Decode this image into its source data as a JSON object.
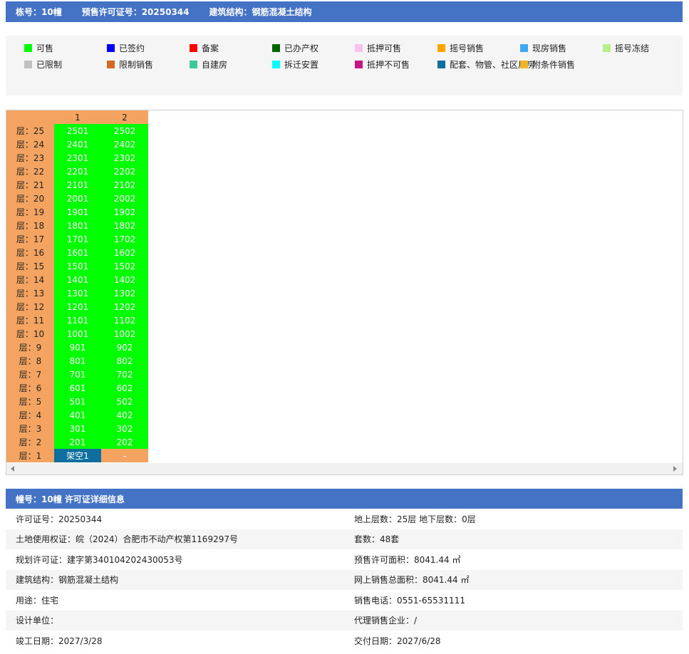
{
  "header": {
    "building": "栋号：10幢",
    "permit": "预售许可证号：20250344",
    "structure": "建筑结构：钢筋混凝土结构"
  },
  "legend": [
    {
      "label": "可售",
      "color": "#00ff00"
    },
    {
      "label": "已签约",
      "color": "#0000ff"
    },
    {
      "label": "备案",
      "color": "#ff0000"
    },
    {
      "label": "已办产权",
      "color": "#006400"
    },
    {
      "label": "抵押可售",
      "color": "#f9c0f2"
    },
    {
      "label": "摇号销售",
      "color": "#ffa500"
    },
    {
      "label": "现房销售",
      "color": "#3fa9f5"
    },
    {
      "label": "摇号冻结",
      "color": "#b3f08a"
    },
    {
      "label": "已限制",
      "color": "#c0c0c0"
    },
    {
      "label": "限制销售",
      "color": "#d2691e"
    },
    {
      "label": "自建房",
      "color": "#40c89a"
    },
    {
      "label": "拆迁安置",
      "color": "#00ffff"
    },
    {
      "label": "抵押不可售",
      "color": "#c71585"
    },
    {
      "label": "配套、物管、社区用房",
      "color": "#0e6e9e"
    },
    {
      "label": "附条件销售",
      "color": "#f0b429"
    }
  ],
  "grid": {
    "columns": [
      "1",
      "2"
    ],
    "floors": [
      {
        "label": "层：25",
        "units": [
          "2501",
          "2502"
        ]
      },
      {
        "label": "层：24",
        "units": [
          "2401",
          "2402"
        ]
      },
      {
        "label": "层：23",
        "units": [
          "2301",
          "2302"
        ]
      },
      {
        "label": "层：22",
        "units": [
          "2201",
          "2202"
        ]
      },
      {
        "label": "层：21",
        "units": [
          "2101",
          "2102"
        ]
      },
      {
        "label": "层：20",
        "units": [
          "2001",
          "2002"
        ]
      },
      {
        "label": "层：19",
        "units": [
          "1901",
          "1902"
        ]
      },
      {
        "label": "层：18",
        "units": [
          "1801",
          "1802"
        ]
      },
      {
        "label": "层：17",
        "units": [
          "1701",
          "1702"
        ]
      },
      {
        "label": "层：16",
        "units": [
          "1601",
          "1602"
        ]
      },
      {
        "label": "层：15",
        "units": [
          "1501",
          "1502"
        ]
      },
      {
        "label": "层：14",
        "units": [
          "1401",
          "1402"
        ]
      },
      {
        "label": "层：13",
        "units": [
          "1301",
          "1302"
        ]
      },
      {
        "label": "层：12",
        "units": [
          "1201",
          "1202"
        ]
      },
      {
        "label": "层：11",
        "units": [
          "1101",
          "1102"
        ]
      },
      {
        "label": "层：10",
        "units": [
          "1001",
          "1002"
        ]
      },
      {
        "label": "层：9",
        "units": [
          "901",
          "902"
        ]
      },
      {
        "label": "层：8",
        "units": [
          "801",
          "802"
        ]
      },
      {
        "label": "层：7",
        "units": [
          "701",
          "702"
        ]
      },
      {
        "label": "层：6",
        "units": [
          "601",
          "602"
        ]
      },
      {
        "label": "层：5",
        "units": [
          "501",
          "502"
        ]
      },
      {
        "label": "层：4",
        "units": [
          "401",
          "402"
        ]
      },
      {
        "label": "层：3",
        "units": [
          "301",
          "302"
        ]
      },
      {
        "label": "层：2",
        "units": [
          "201",
          "202"
        ]
      },
      {
        "label": "层：1",
        "units": [
          "架空1",
          "-"
        ]
      }
    ]
  },
  "details": {
    "title": "幢号：10幢 许可证详细信息",
    "rows": [
      [
        "许可证号：20250344",
        "地上层数：25层  地下层数：0层"
      ],
      [
        "土地使用权证：皖（2024）合肥市不动产权第1169297号",
        "套数：48套"
      ],
      [
        "规划许可证：建字第340104202430053号",
        "预售许可面积：8041.44 ㎡"
      ],
      [
        "建筑结构：钢筋混凝土结构",
        "网上销售总面积：8041.44 ㎡"
      ],
      [
        "用途：住宅",
        "销售电话：0551-65531111"
      ],
      [
        "设计单位：",
        "代理销售企业：/"
      ],
      [
        "竣工日期：2027/3/28",
        "交付日期：2027/6/28"
      ]
    ]
  }
}
